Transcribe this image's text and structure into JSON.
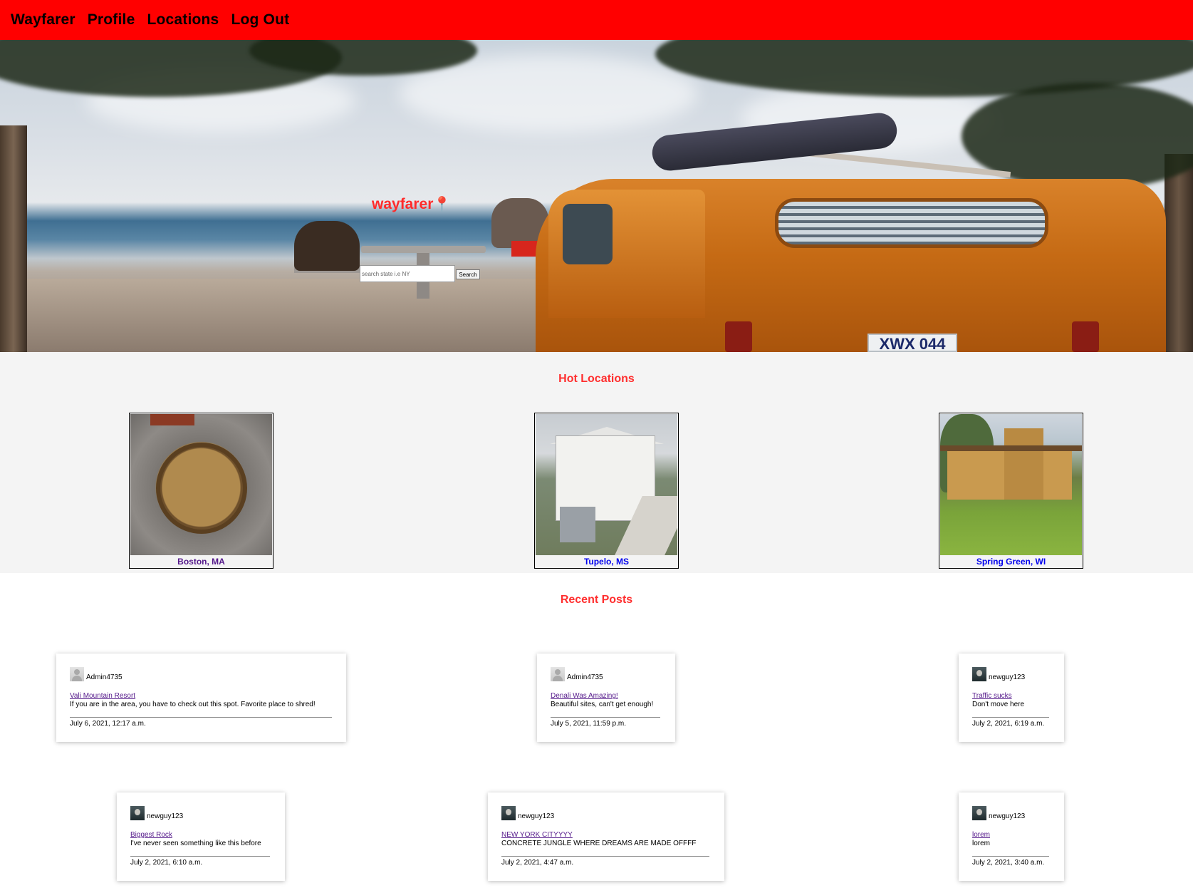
{
  "nav": {
    "brand": "Wayfarer",
    "items": [
      "Profile",
      "Locations",
      "Log Out"
    ],
    "color": "#ff0000"
  },
  "hero": {
    "title": "wayfarer",
    "pin_icon": "map-pin-icon",
    "search_placeholder": "search state i.e NY",
    "search_value": "",
    "search_button": "Search",
    "image": "orange-van-beach-photo",
    "plate_text": "XWX 044"
  },
  "hot_locations": {
    "title": "Hot Locations",
    "items": [
      {
        "name": "Boston, MA",
        "image": "freedom-trail-marker-photo",
        "visited": true
      },
      {
        "name": "Tupelo, MS",
        "image": "white-house-photo",
        "visited": false
      },
      {
        "name": "Spring Green, WI",
        "image": "prairie-house-photo",
        "visited": false
      }
    ]
  },
  "recent_posts": {
    "title": "Recent Posts",
    "posts": [
      {
        "user": "Admin4735",
        "avatar": "default-avatar-icon",
        "title": "Vali Mountain Resort",
        "body": "If you are in the area, you have to check out this spot. Favorite place to shred!",
        "date": "July 6, 2021, 12:17 a.m."
      },
      {
        "user": "Admin4735",
        "avatar": "default-avatar-icon",
        "title": "Denali Was Amazing!",
        "body": "Beautiful sites, can't get enough!",
        "date": "July 5, 2021, 11:59 p.m."
      },
      {
        "user": "newguy123",
        "avatar": "user-photo-avatar",
        "title": "Traffic sucks",
        "body": "Don't move here",
        "date": "July 2, 2021, 6:19 a.m."
      },
      {
        "user": "newguy123",
        "avatar": "user-photo-avatar",
        "title": "Biggest Rock",
        "body": "I've never seen something like this before",
        "date": "July 2, 2021, 6:10 a.m."
      },
      {
        "user": "newguy123",
        "avatar": "user-photo-avatar",
        "title": "NEW YORK CITYYYY",
        "body": "CONCRETE JUNGLE WHERE DREAMS ARE MADE OFFFF",
        "date": "July 2, 2021, 4:47 a.m."
      },
      {
        "user": "newguy123",
        "avatar": "user-photo-avatar",
        "title": "lorem",
        "body": "lorem",
        "date": "July 2, 2021, 3:40 a.m."
      }
    ]
  },
  "colors": {
    "accent_red": "#ff2f2f",
    "link_visited": "#551a8b",
    "link_unvisited": "#0000ee"
  }
}
